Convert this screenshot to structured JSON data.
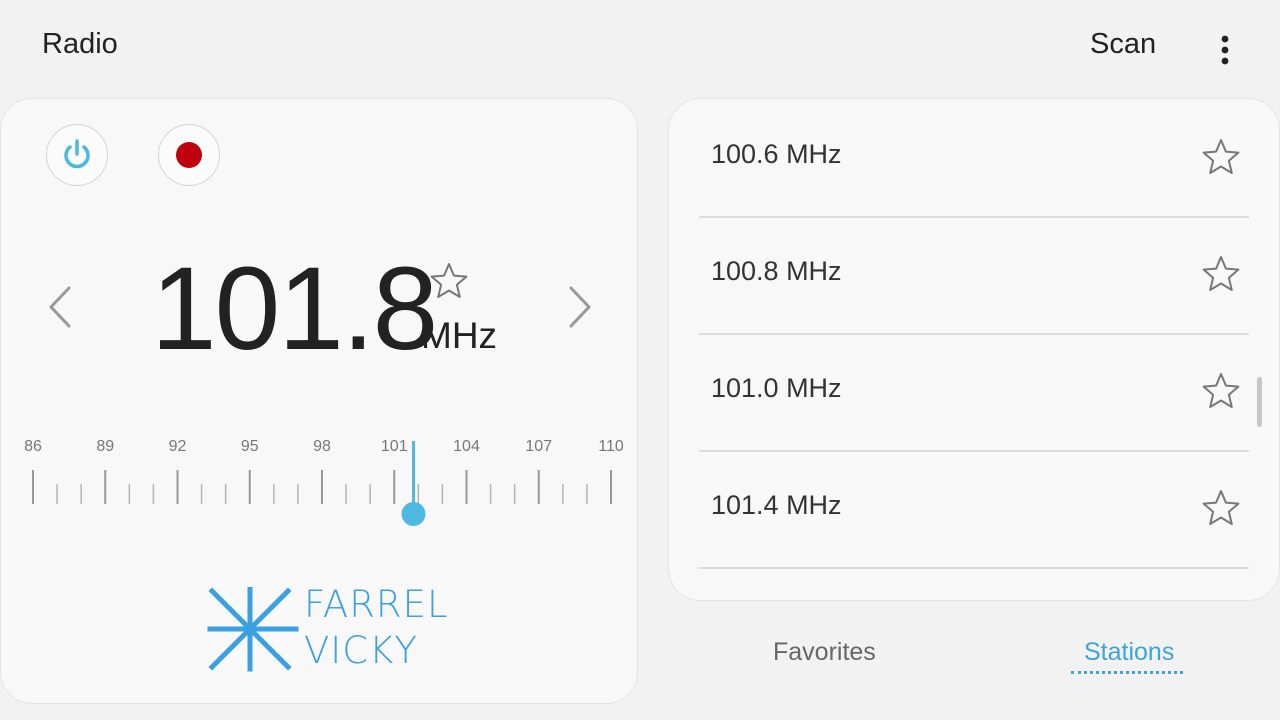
{
  "header": {
    "title": "Radio",
    "scan_label": "Scan",
    "more_icon": "vertical-ellipsis-icon"
  },
  "tuner": {
    "frequency": "101.8",
    "unit": "MHz",
    "power_icon": "power-icon",
    "record_icon": "record-icon",
    "accent_color": "#4fb8e0",
    "record_color": "#c0000f",
    "scale_labels": [
      "86",
      "89",
      "92",
      "95",
      "98",
      "101",
      "104",
      "107",
      "110"
    ],
    "scale_min": 86,
    "scale_max": 110,
    "tuned_value": 101.8,
    "logo_lines": [
      "FARREL",
      "VICKY"
    ]
  },
  "stations": [
    {
      "label": "100.6 MHz",
      "favorite": false
    },
    {
      "label": "100.8 MHz",
      "favorite": false
    },
    {
      "label": "101.0 MHz",
      "favorite": false
    },
    {
      "label": "101.4 MHz",
      "favorite": false
    }
  ],
  "tabs": {
    "favorites": "Favorites",
    "stations": "Stations",
    "active": "stations",
    "active_color": "#3aa6d8"
  }
}
